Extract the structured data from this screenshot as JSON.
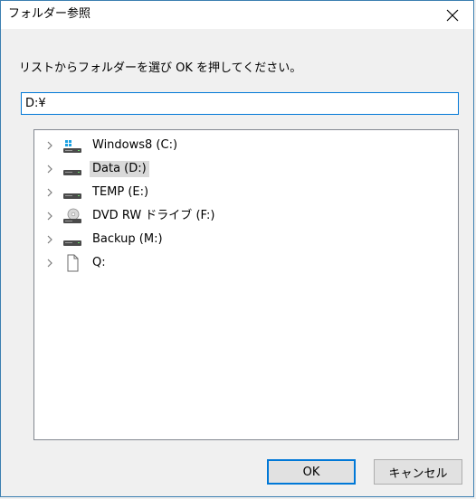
{
  "dialog": {
    "title": "フォルダー参照",
    "instruction": "リストからフォルダーを選び OK を押してください。"
  },
  "path_input": {
    "value": "D:¥"
  },
  "tree": {
    "items": [
      {
        "label": "Windows8 (C:)",
        "icon": "windows-drive-icon",
        "selected": false
      },
      {
        "label": "Data (D:)",
        "icon": "drive-icon",
        "selected": true
      },
      {
        "label": "TEMP (E:)",
        "icon": "drive-icon",
        "selected": false
      },
      {
        "label": "DVD RW ドライブ (F:)",
        "icon": "dvd-drive-icon",
        "selected": false
      },
      {
        "label": "Backup (M:)",
        "icon": "drive-icon",
        "selected": false
      },
      {
        "label": "Q:",
        "icon": "document-icon",
        "selected": false
      }
    ]
  },
  "buttons": {
    "ok": "OK",
    "cancel": "キャンセル"
  },
  "colors": {
    "accent": "#0078d7",
    "selection": "#d9d9d9",
    "window_border": "#3c7fb1"
  }
}
